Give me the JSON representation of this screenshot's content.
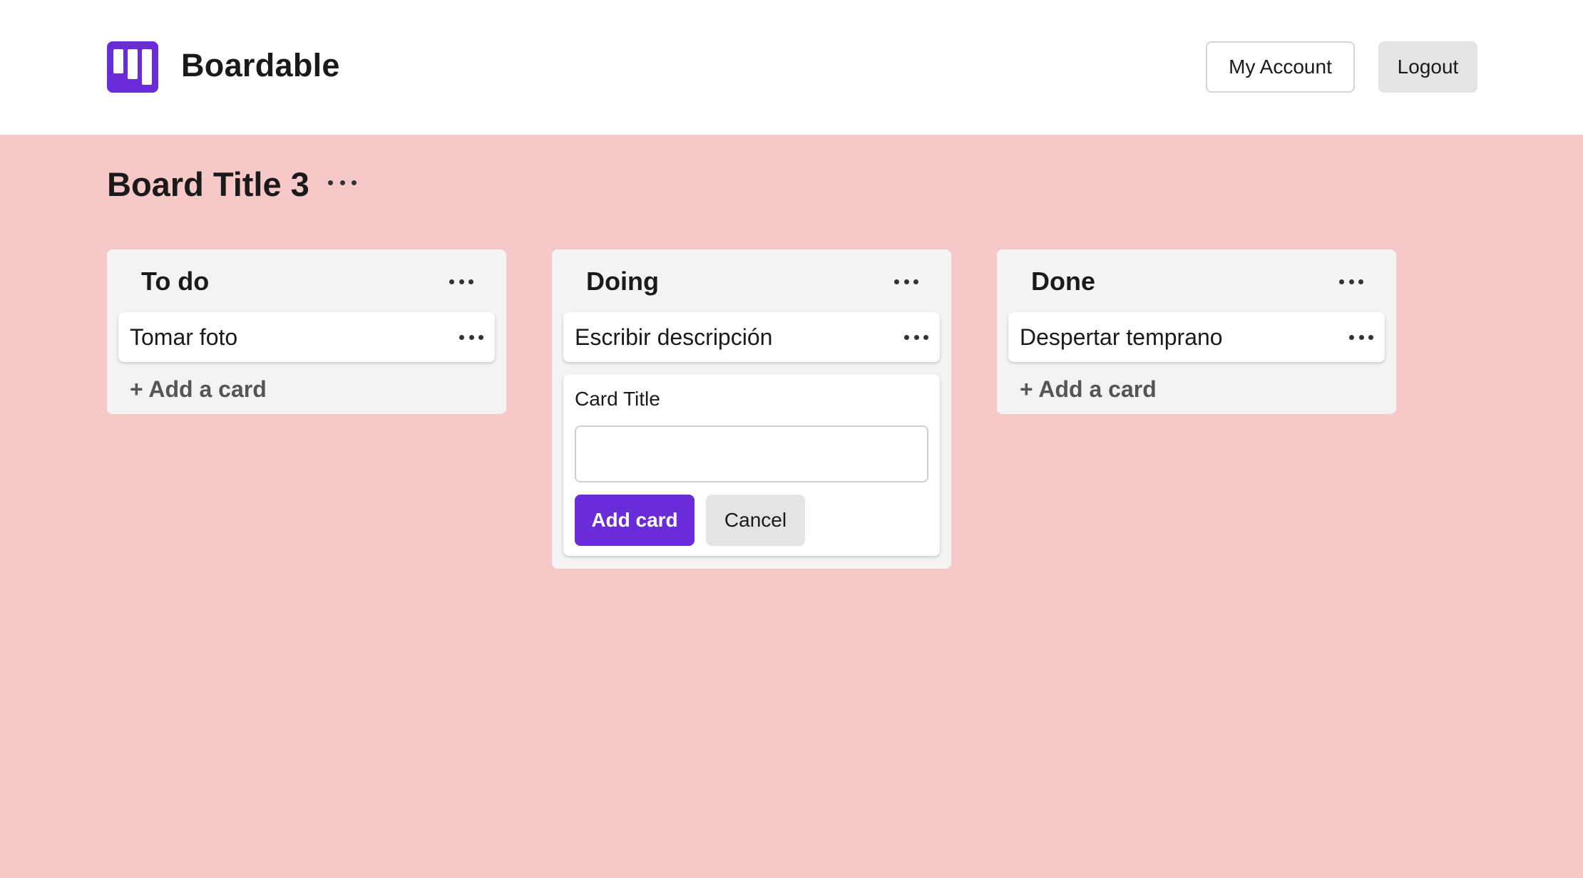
{
  "header": {
    "brand": "Boardable",
    "account_label": "My Account",
    "logout_label": "Logout"
  },
  "board": {
    "title": "Board Title 3",
    "background": "#f6c8c8"
  },
  "columns": [
    {
      "title": "To do",
      "cards": [
        "Tomar foto"
      ],
      "add_label": "+ Add a card"
    },
    {
      "title": "Doing",
      "cards": [
        "Escribir descripción"
      ]
    },
    {
      "title": "Done",
      "cards": [
        "Despertar temprano"
      ],
      "add_label": "+ Add a card"
    }
  ],
  "new_card_form": {
    "label": "Card Title",
    "value": "",
    "submit_label": "Add card",
    "cancel_label": "Cancel"
  },
  "colors": {
    "accent": "#6a2bd9",
    "column_bg": "#f3f3f3"
  },
  "icons": {
    "logo": "board-columns-icon",
    "menu": "more-horizontal-icon"
  }
}
